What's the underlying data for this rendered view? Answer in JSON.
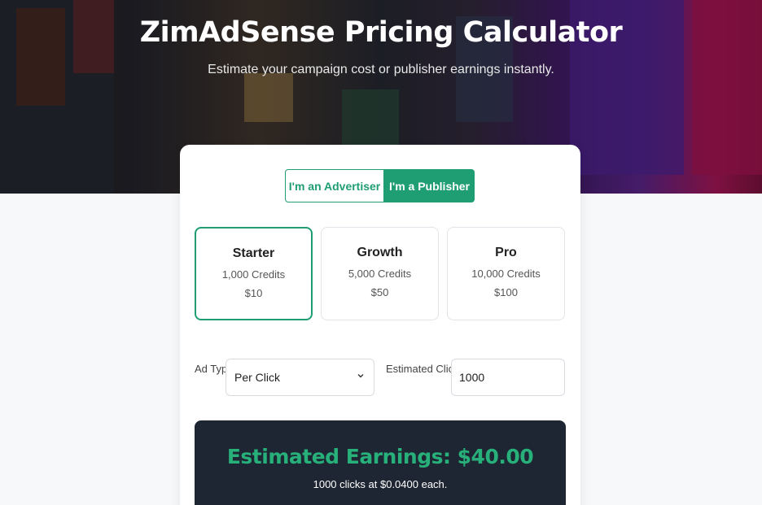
{
  "hero": {
    "title": "ZimAdSense Pricing Calculator",
    "subtitle": "Estimate your campaign cost or publisher earnings instantly."
  },
  "roles": {
    "advertiser_label": "I'm an Advertiser",
    "publisher_label": "I'm a Publisher",
    "active": "publisher"
  },
  "plans": [
    {
      "name": "Starter",
      "credits": "1,000 Credits",
      "price": "$10",
      "selected": true
    },
    {
      "name": "Growth",
      "credits": "5,000 Credits",
      "price": "$50",
      "selected": false
    },
    {
      "name": "Pro",
      "credits": "10,000 Credits",
      "price": "$100",
      "selected": false
    }
  ],
  "form": {
    "ad_type_label": "Ad Type",
    "ad_type_value": "Per Click",
    "clicks_label": "Estimated Clicks",
    "clicks_value": "1000"
  },
  "result": {
    "headline": "Estimated Earnings: $40.00",
    "detail": "1000 clicks at $0.0400 each."
  },
  "colors": {
    "accent": "#1f9d73",
    "result_bg": "#1e2633",
    "result_text": "#27b07a"
  }
}
